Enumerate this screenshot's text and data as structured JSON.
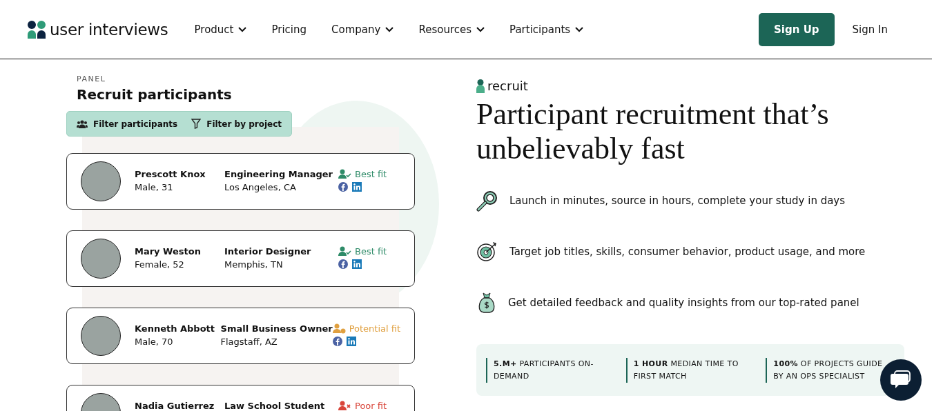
{
  "nav": {
    "logo": "user interviews",
    "items": [
      {
        "label": "Product",
        "dropdown": true
      },
      {
        "label": "Pricing",
        "dropdown": false
      },
      {
        "label": "Company",
        "dropdown": true
      },
      {
        "label": "Resources",
        "dropdown": true
      },
      {
        "label": "Participants",
        "dropdown": true
      }
    ],
    "sign_up": "Sign Up",
    "sign_in": "Sign In"
  },
  "panel": {
    "eyebrow": "PANEL",
    "title": "Recruit participants",
    "filters": [
      {
        "kind": "people",
        "label": "Filter participants"
      },
      {
        "kind": "funnel",
        "label": "Filter by project"
      }
    ],
    "participants": [
      {
        "name": "Prescott Knox",
        "details": "Male, 31",
        "job": "Engineering Manager",
        "location": "Los Angeles, CA",
        "fit": {
          "kind": "best",
          "label": "Best fit",
          "color": "#2e8b68"
        }
      },
      {
        "name": "Mary Weston",
        "details": "Female, 52",
        "job": "Interior Designer",
        "location": "Memphis, TN",
        "fit": {
          "kind": "best",
          "label": "Best fit",
          "color": "#2e8b68"
        }
      },
      {
        "name": "Kenneth Abbott",
        "details": "Male, 70",
        "job": "Small Business Owner",
        "location": "Flagstaff, AZ",
        "fit": {
          "kind": "potential",
          "label": "Potential fit",
          "color": "#e0a040"
        }
      },
      {
        "name": "Nadia Gutierrez",
        "job": "Law School Student",
        "fit": {
          "kind": "poor",
          "label": "Poor fit",
          "color": "#d9453a"
        }
      }
    ]
  },
  "hero": {
    "tag": "recruit",
    "title": "Participant recruitment that’s unbelievably fast",
    "features": [
      {
        "kind": "magnifier",
        "text": "Launch in minutes, source in hours, complete your study in days"
      },
      {
        "kind": "target",
        "text": "Target job titles, skills, consumer behavior, product usage, and more"
      },
      {
        "kind": "moneybag",
        "text": "Get detailed feedback and quality insights from our top-rated panel"
      }
    ],
    "stats": [
      "**5.M+** PARTICIPANTS ON-DEMAND",
      "**1 HOUR** MEDIAN TIME TO FIRST MATCH",
      "**100%** OF PROJECTS GUIDE BY AN OPS SPECIALIST"
    ]
  }
}
